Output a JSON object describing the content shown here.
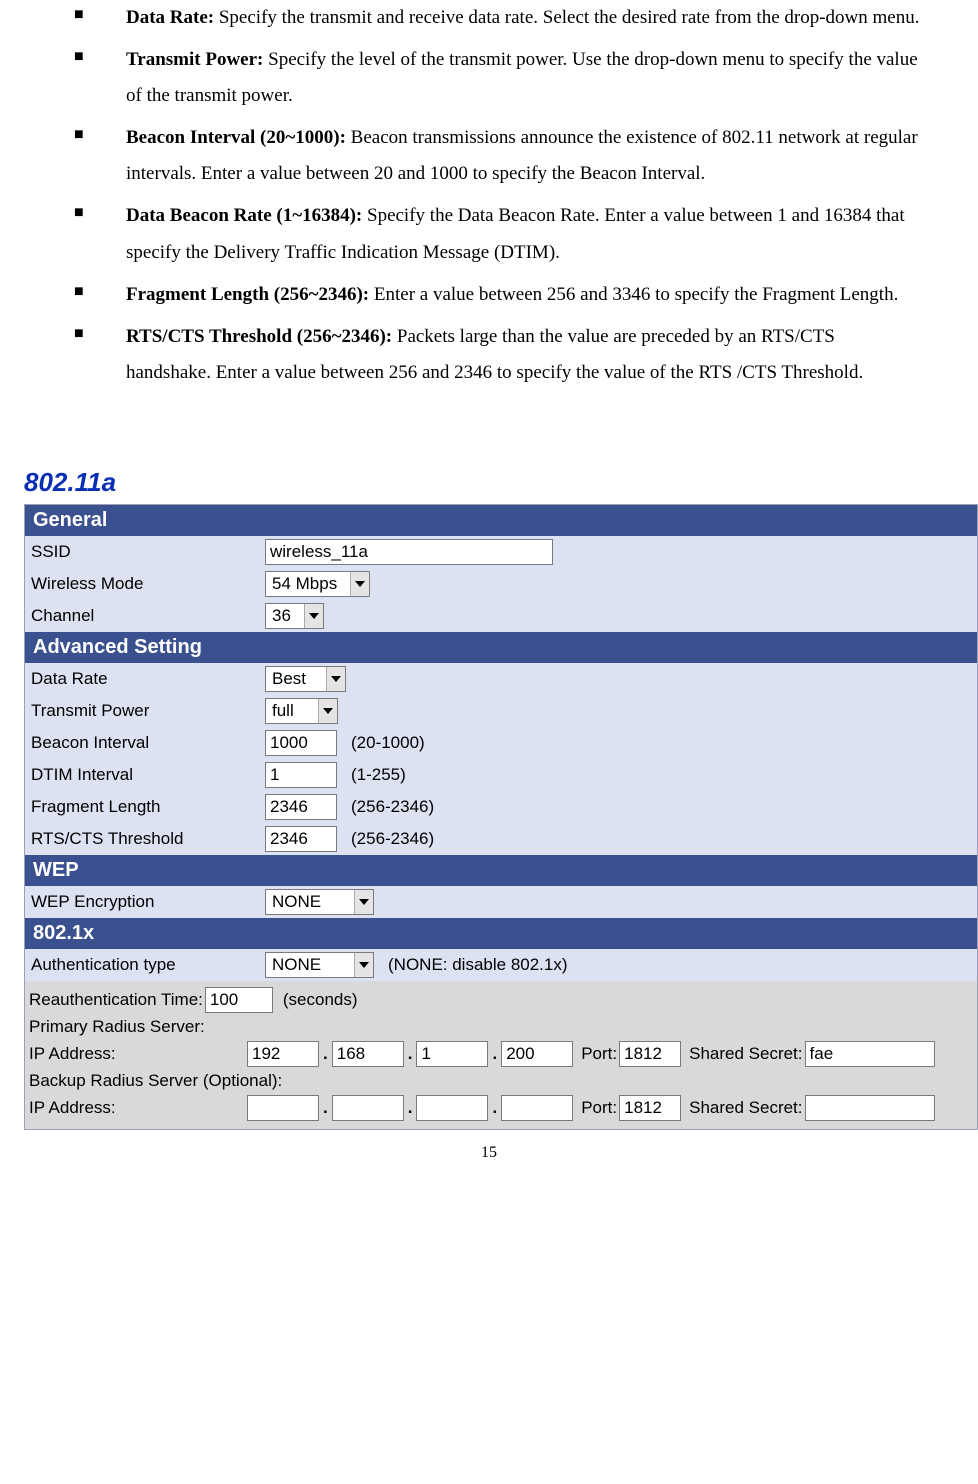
{
  "bullets": [
    {
      "label": "Data Rate:",
      "text": " Specify the transmit and receive data rate. Select the desired rate from the drop-down menu."
    },
    {
      "label": "Transmit Power:",
      "text": " Specify the level of the transmit power. Use the drop-down menu to specify the value of the transmit power."
    },
    {
      "label": "Beacon Interval (20~1000):",
      "text": " Beacon transmissions announce the existence of 802.11 network at regular intervals. Enter a value between 20 and 1000 to specify the Beacon Interval."
    },
    {
      "label": "Data Beacon Rate (1~16384):",
      "text": " Specify the Data Beacon Rate. Enter a value between 1 and 16384 that specify the Delivery Traffic Indication Message (DTIM)."
    },
    {
      "label": "Fragment Length (256~2346):",
      "text": " Enter a value between 256 and 3346 to specify the Fragment Length."
    },
    {
      "label": "RTS/CTS Threshold (256~2346):",
      "text": " Packets large than the value are preceded by an RTS/CTS handshake. Enter a value between 256 and 2346 to specify the value of the RTS /CTS Threshold."
    }
  ],
  "heading": "802.11a",
  "sections": {
    "general": "General",
    "advanced": "Advanced Setting",
    "wep": "WEP",
    "dot1x": "802.1x"
  },
  "general": {
    "ssid_label": "SSID",
    "ssid_value": "wireless_11a",
    "mode_label": "Wireless Mode",
    "mode_value": "54 Mbps",
    "channel_label": "Channel",
    "channel_value": "36"
  },
  "advanced": {
    "datarate_label": "Data Rate",
    "datarate_value": "Best",
    "txpower_label": "Transmit Power",
    "txpower_value": "full",
    "beacon_label": "Beacon Interval",
    "beacon_value": "1000",
    "beacon_hint": "(20-1000)",
    "dtim_label": "DTIM Interval",
    "dtim_value": "1",
    "dtim_hint": "(1-255)",
    "frag_label": "Fragment Length",
    "frag_value": "2346",
    "frag_hint": "(256-2346)",
    "rts_label": "RTS/CTS Threshold",
    "rts_value": "2346",
    "rts_hint": "(256-2346)"
  },
  "wep": {
    "enc_label": "WEP Encryption",
    "enc_value": "NONE"
  },
  "dot1x": {
    "auth_label": "Authentication type",
    "auth_value": "NONE",
    "auth_hint": "(NONE: disable 802.1x)"
  },
  "radius": {
    "reauth_label": "Reauthentication Time:",
    "reauth_value": "100",
    "reauth_hint": "(seconds)",
    "primary_label": "Primary Radius Server:",
    "ip_label": "IP Address:",
    "p_ip1": "192",
    "p_ip2": "168",
    "p_ip3": "1",
    "p_ip4": "200",
    "port_label": "Port:",
    "p_port": "1812",
    "secret_label": "Shared Secret:",
    "p_secret": "fae",
    "backup_label": "Backup Radius Server (Optional):",
    "b_ip1": "",
    "b_ip2": "",
    "b_ip3": "",
    "b_ip4": "",
    "b_port": "1812",
    "b_secret": ""
  },
  "page_number": "15"
}
